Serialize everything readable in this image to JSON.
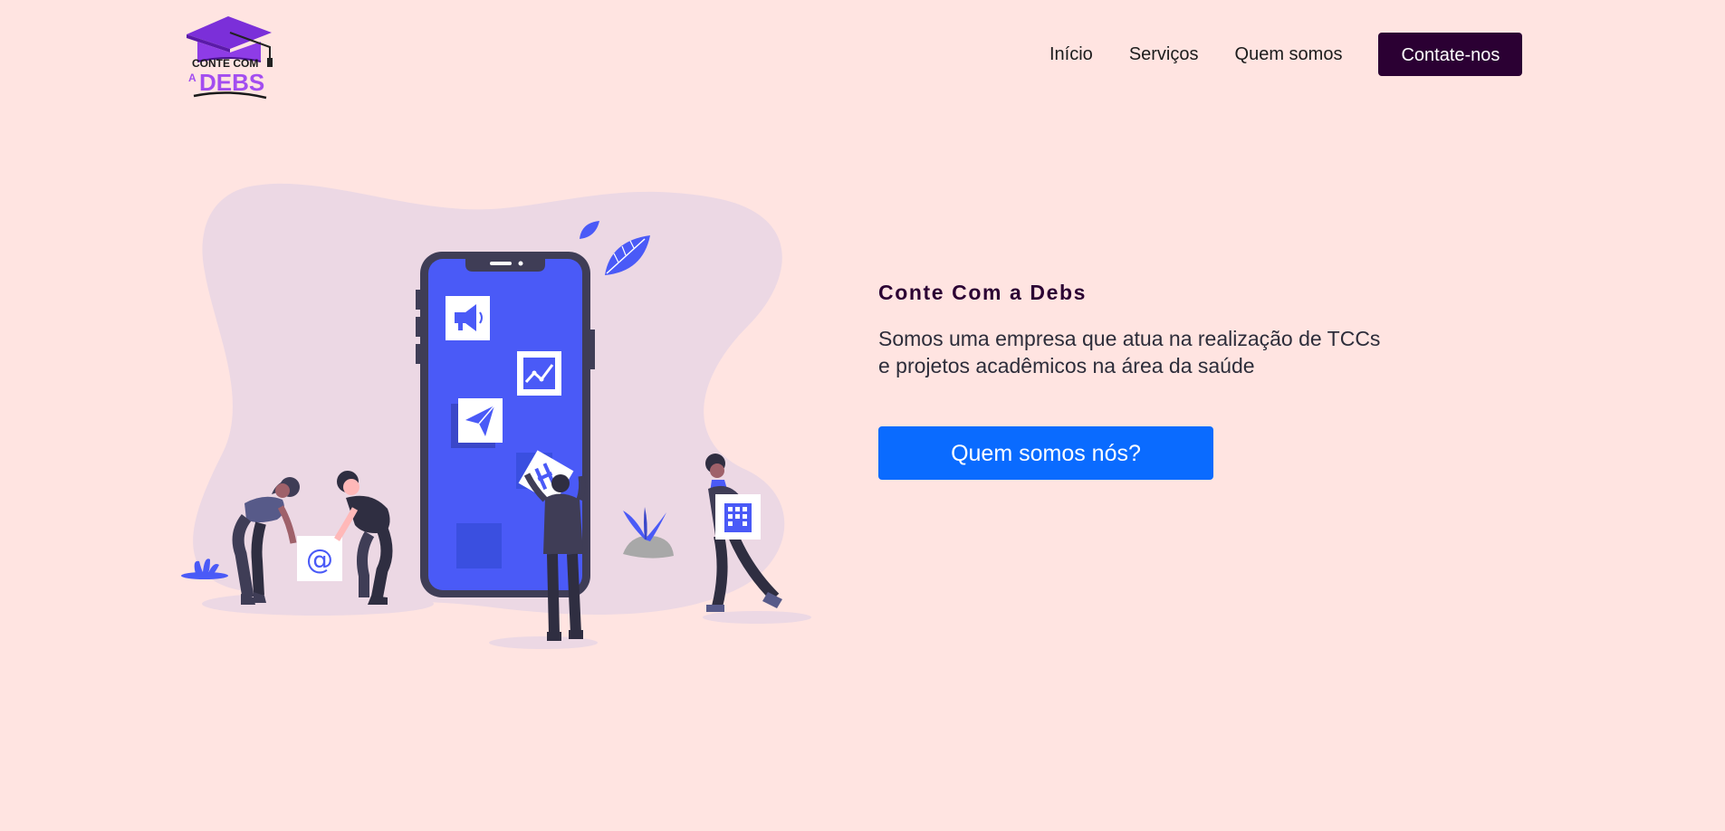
{
  "header": {
    "logo": {
      "line1": "CONTE COM",
      "line2_prefix": "A",
      "line2": "DEBS",
      "colors": {
        "cap": "#7b2fd9",
        "cap_dark": "#5a1aa8",
        "text_dark": "#1a1a1a",
        "text_purple": "#a34df0"
      }
    },
    "nav": {
      "items": [
        {
          "label": "Início",
          "icon": "link"
        },
        {
          "label": "Serviços",
          "icon": "link"
        },
        {
          "label": "Quem somos",
          "icon": "link"
        }
      ],
      "contact_label": "Contate-nos"
    }
  },
  "hero": {
    "title": "Conte Com a Debs",
    "description_lines": [
      "Somos uma empresa que atua na realização de TCCs",
      "e projetos acadêmicos na área da saúde"
    ],
    "button_label": "Quem somos nós?",
    "illustration": {
      "icons": [
        "megaphone-icon",
        "chart-icon",
        "paper-plane-icon",
        "at-sign-icon",
        "building-icon",
        "leaf-icon"
      ],
      "at_symbol": "@",
      "colors": {
        "blob": "#ecd8e4",
        "phone": "#3f3d56",
        "screen": "#4a5af7",
        "accent": "#3a4fe0",
        "stone": "#a8a8a8"
      }
    }
  },
  "colors": {
    "background": "#ffe4e1",
    "contact_button": "#2b0033",
    "primary_button": "#0a6bff",
    "title": "#2b0033"
  }
}
